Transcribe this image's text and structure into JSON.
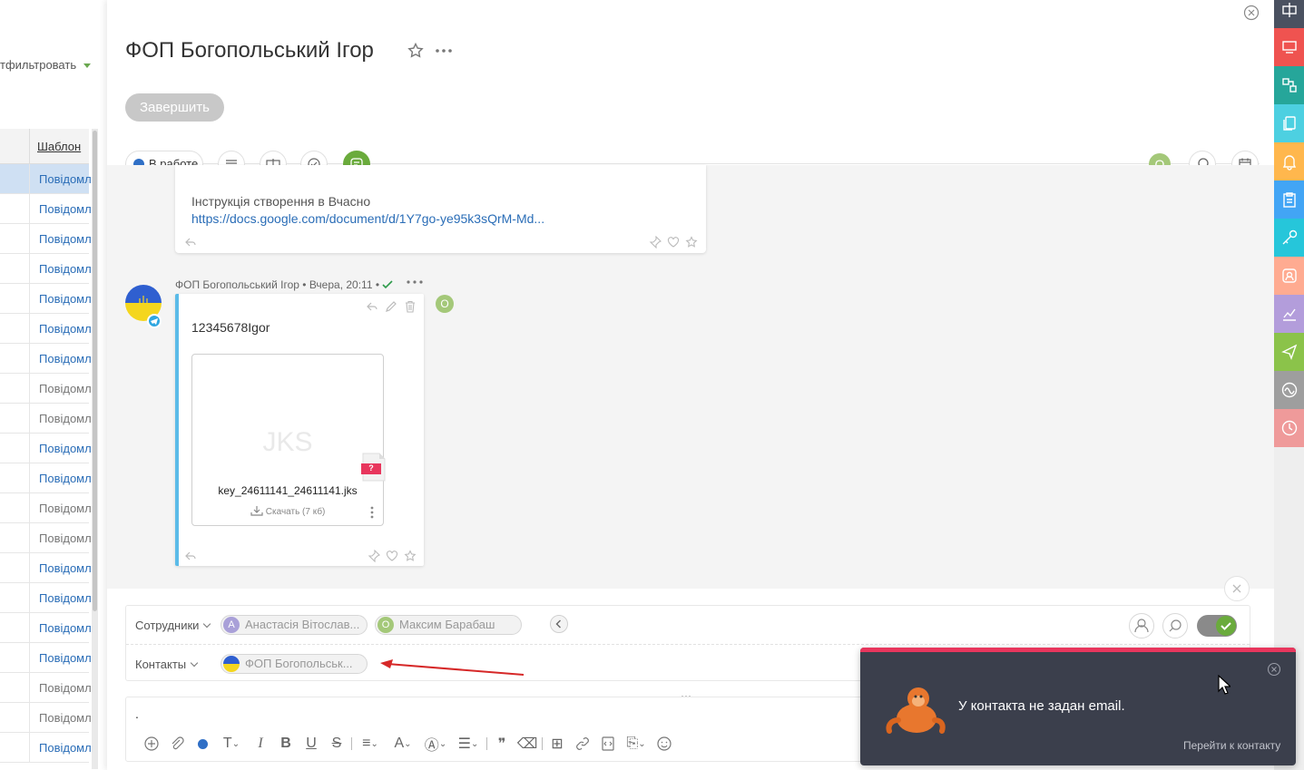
{
  "background_list": {
    "filter_label": "тфильтровать",
    "column_header": "Шаблон",
    "rows": [
      {
        "text": "Повідомл",
        "selected": true,
        "color": "#2a6db7"
      },
      {
        "text": "Повідомл",
        "color": "#2a6db7"
      },
      {
        "text": "Повідомл",
        "color": "#2a6db7"
      },
      {
        "text": "Повідомл",
        "color": "#2a6db7"
      },
      {
        "text": "Повідомл",
        "color": "#2a6db7"
      },
      {
        "text": "Повідомл",
        "color": "#2a6db7"
      },
      {
        "text": "Повідомл",
        "color": "#2a6db7"
      },
      {
        "text": "Повідомл",
        "color": "#777777"
      },
      {
        "text": "Повідомл",
        "color": "#777777"
      },
      {
        "text": "Повідомл",
        "color": "#2a6db7"
      },
      {
        "text": "Повідомл",
        "color": "#2a6db7"
      },
      {
        "text": "Повідомл",
        "color": "#777777"
      },
      {
        "text": "Повідомл",
        "color": "#777777"
      },
      {
        "text": "Повідомл",
        "color": "#2a6db7"
      },
      {
        "text": "Повідомл",
        "color": "#2a6db7"
      },
      {
        "text": "Повідомл",
        "color": "#2a6db7"
      },
      {
        "text": "Повідомл",
        "color": "#2a6db7"
      },
      {
        "text": "Повідомл",
        "color": "#777777"
      },
      {
        "text": "Повідомл",
        "color": "#777777"
      },
      {
        "text": "Повідомл",
        "color": "#2a6db7"
      }
    ]
  },
  "header": {
    "title": "ФОП Богопольський Ігор",
    "finish_button": "Завершить",
    "status": "В работе",
    "status_color": "#2f6fc6",
    "avatar_initial": "О"
  },
  "feed": {
    "message1": {
      "text": "Інструкція створення в Вчасно",
      "link": "https://docs.google.com/document/d/1Y7go-ye95k3sQrM-Md..."
    },
    "message2": {
      "author_meta": "ФОП Богопольський Ігор • Вчера, 20:11 •",
      "text": "12345678Igor",
      "file": {
        "ext": "JKS",
        "name": "key_24611141_24611141.jks",
        "download": "Скачать  (7 кб)",
        "badge": "?"
      },
      "reader_initial": "О"
    }
  },
  "composer": {
    "employees_label": "Сотрудники",
    "employees": [
      {
        "initial": "А",
        "name": "Анастасія Вітослав...",
        "color": "#a9a0d8"
      },
      {
        "initial": "О",
        "name": "Максим Барабаш",
        "color": "#a4c879"
      }
    ],
    "contacts_label": "Контакты",
    "contacts": [
      {
        "name": "ФОП Богопольськ..."
      }
    ],
    "editor_text": ".",
    "toggle_on": true
  },
  "right_strip": [
    {
      "icon": "columns-icon",
      "color": "#4a5160"
    },
    {
      "icon": "layout-icon",
      "color": "#ef5350"
    },
    {
      "icon": "flow-icon",
      "color": "#26a69a"
    },
    {
      "icon": "copy-icon",
      "color": "#4dd0e1"
    },
    {
      "icon": "bell-icon",
      "color": "#ffb74d"
    },
    {
      "icon": "clipboard-icon",
      "color": "#42a5f5"
    },
    {
      "icon": "key-icon",
      "color": "#26c6da"
    },
    {
      "icon": "contact-icon",
      "color": "#ffab91"
    },
    {
      "icon": "chart-icon",
      "color": "#b39ddb"
    },
    {
      "icon": "send-icon",
      "color": "#8bc34a"
    },
    {
      "icon": "wave-icon",
      "color": "#9e9e9e"
    },
    {
      "icon": "clock-icon",
      "color": "#ef9a9a"
    }
  ],
  "toast": {
    "message": "У контакта не задан email.",
    "link": "Перейти к контакту",
    "accent": "#e8365d"
  }
}
